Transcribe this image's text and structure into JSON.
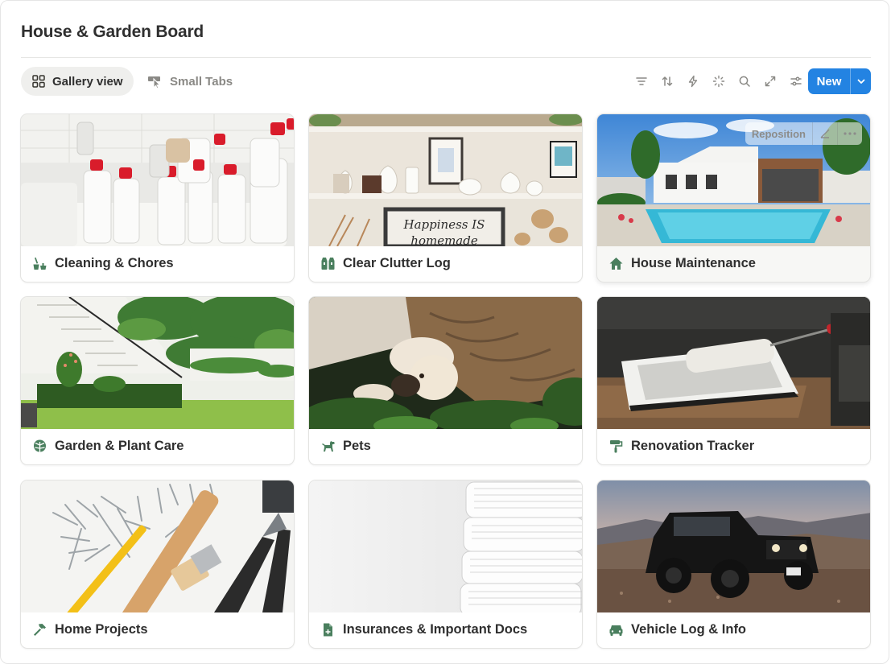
{
  "board": {
    "title": "House & Garden Board"
  },
  "tabs": [
    {
      "label": "Gallery view",
      "icon": "gallery-grid-icon",
      "active": true
    },
    {
      "label": "Small Tabs",
      "icon": "cursor-click-icon",
      "active": false
    }
  ],
  "toolbar": {
    "icons": [
      "filter-icon",
      "sort-icon",
      "automation-bolt-icon",
      "sparkle-icon",
      "search-icon",
      "expand-icon",
      "settings-sliders-icon"
    ],
    "new_label": "New"
  },
  "hover_menu": {
    "reposition_label": "Reposition"
  },
  "colors": {
    "accent": "#2383e2",
    "icon_green": "#4a7f5e",
    "muted": "#8a8985"
  },
  "cards": [
    {
      "label": "Cleaning & Chores",
      "icon": "broom-bucket-icon",
      "cover": "cleaning-bottles"
    },
    {
      "label": "Clear Clutter Log",
      "icon": "boxes-icon",
      "cover": "shelf-pottery"
    },
    {
      "label": "House Maintenance",
      "icon": "house-icon",
      "cover": "house-pool"
    },
    {
      "label": "Garden & Plant Care",
      "icon": "monstera-leaf-icon",
      "cover": "garden-stairs"
    },
    {
      "label": "Pets",
      "icon": "dog-icon",
      "cover": "cat-and-dog"
    },
    {
      "label": "Renovation Tracker",
      "icon": "paint-roller-icon",
      "cover": "paint-tray"
    },
    {
      "label": "Home Projects",
      "icon": "hammer-icon",
      "cover": "tools-nails"
    },
    {
      "label": "Insurances & Important Docs",
      "icon": "document-plus-icon",
      "cover": "book-stack"
    },
    {
      "label": "Vehicle Log & Info",
      "icon": "car-icon",
      "cover": "black-jeep"
    }
  ]
}
